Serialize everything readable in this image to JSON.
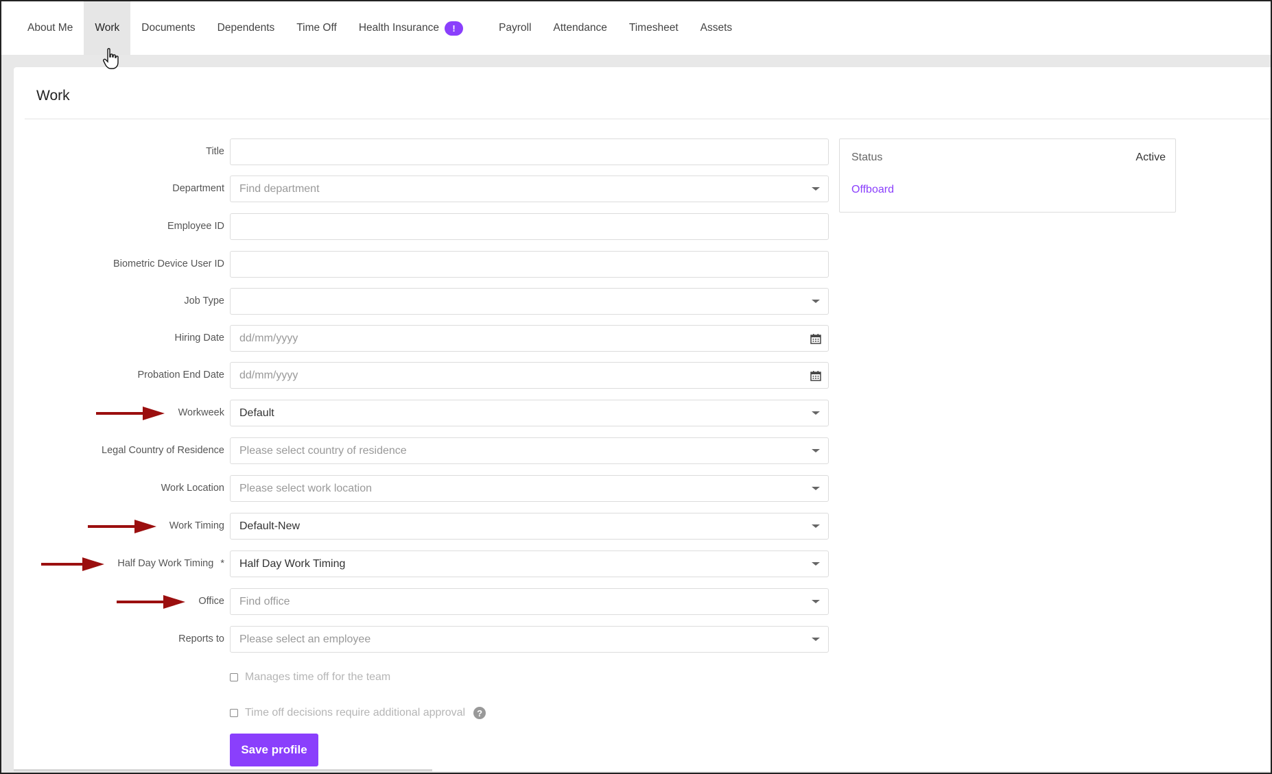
{
  "tabs": [
    {
      "label": "About Me"
    },
    {
      "label": "Work"
    },
    {
      "label": "Documents"
    },
    {
      "label": "Dependents"
    },
    {
      "label": "Time Off"
    },
    {
      "label": "Health Insurance",
      "badge": "!"
    },
    {
      "label": "Payroll"
    },
    {
      "label": "Attendance"
    },
    {
      "label": "Timesheet"
    },
    {
      "label": "Assets"
    }
  ],
  "active_tab": "Work",
  "page": {
    "title": "Work"
  },
  "form": {
    "title": {
      "label": "Title",
      "value": ""
    },
    "department": {
      "label": "Department",
      "placeholder": "Find department"
    },
    "employee_id": {
      "label": "Employee ID",
      "value": ""
    },
    "biometric_id": {
      "label": "Biometric Device User ID",
      "value": ""
    },
    "job_type": {
      "label": "Job Type",
      "value": ""
    },
    "hiring_date": {
      "label": "Hiring Date",
      "placeholder": "dd/mm/yyyy"
    },
    "probation_end_date": {
      "label": "Probation End Date",
      "placeholder": "dd/mm/yyyy"
    },
    "workweek": {
      "label": "Workweek",
      "value": "Default"
    },
    "country": {
      "label": "Legal Country of Residence",
      "placeholder": "Please select country of residence"
    },
    "work_location": {
      "label": "Work Location",
      "placeholder": "Please select work location"
    },
    "work_timing": {
      "label": "Work Timing",
      "value": "Default-New"
    },
    "half_day_timing": {
      "label": "Half Day Work Timing",
      "required_mark": "*",
      "value": "Half Day Work Timing"
    },
    "office": {
      "label": "Office",
      "placeholder": "Find office"
    },
    "reports_to": {
      "label": "Reports to",
      "placeholder": "Please select an employee"
    },
    "manages_time_off": {
      "label": "Manages time off for the team",
      "checked": false
    },
    "additional_approval": {
      "label": "Time off decisions require additional approval",
      "checked": false
    },
    "save_label": "Save profile"
  },
  "status": {
    "label": "Status",
    "value": "Active",
    "offboard_label": "Offboard"
  },
  "colors": {
    "accent": "#8a3ffc",
    "arrow": "#9b0f0f"
  },
  "icons": {
    "help": "?"
  }
}
